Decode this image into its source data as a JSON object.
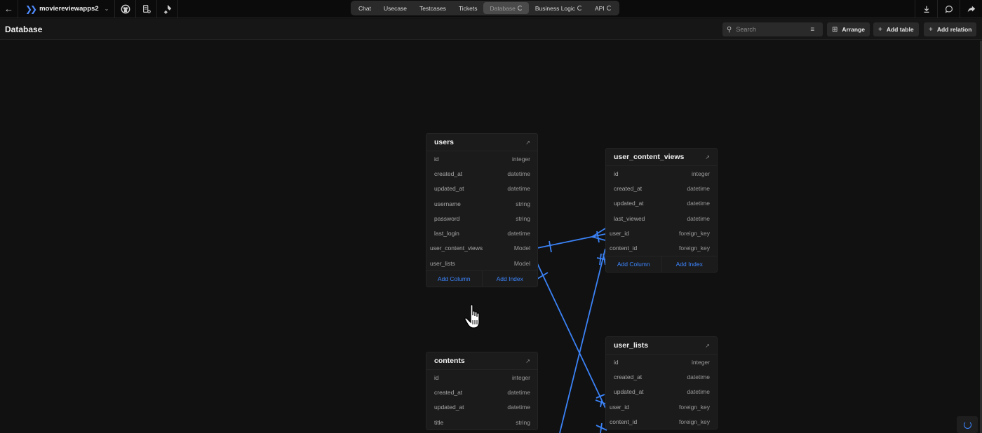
{
  "topbar": {
    "project_name": "moviereviewapps2",
    "tabs": [
      {
        "label": "Chat",
        "active": false,
        "spinner": false
      },
      {
        "label": "Usecase",
        "active": false,
        "spinner": false
      },
      {
        "label": "Testcases",
        "active": false,
        "spinner": false
      },
      {
        "label": "Tickets",
        "active": false,
        "spinner": false
      },
      {
        "label": "Database",
        "active": true,
        "spinner": true
      },
      {
        "label": "Business Logic",
        "active": false,
        "spinner": true
      },
      {
        "label": "API",
        "active": false,
        "spinner": true
      }
    ]
  },
  "header": {
    "title": "Database",
    "search_placeholder": "Search",
    "arrange_label": "Arrange",
    "add_table_label": "Add table",
    "add_relation_label": "Add relation"
  },
  "tables": [
    {
      "name": "users",
      "columns": [
        {
          "name": "id",
          "type": "integer"
        },
        {
          "name": "created_at",
          "type": "datetime"
        },
        {
          "name": "updated_at",
          "type": "datetime"
        },
        {
          "name": "username",
          "type": "string"
        },
        {
          "name": "password",
          "type": "string"
        },
        {
          "name": "last_login",
          "type": "datetime"
        },
        {
          "name": "user_content_views",
          "type": "Model"
        },
        {
          "name": "user_lists",
          "type": "Model"
        }
      ],
      "add_column_label": "Add Column",
      "add_index_label": "Add Index"
    },
    {
      "name": "user_content_views",
      "columns": [
        {
          "name": "id",
          "type": "integer"
        },
        {
          "name": "created_at",
          "type": "datetime"
        },
        {
          "name": "updated_at",
          "type": "datetime"
        },
        {
          "name": "last_viewed",
          "type": "datetime"
        },
        {
          "name": "user_id",
          "type": "foreign_key"
        },
        {
          "name": "content_id",
          "type": "foreign_key"
        }
      ],
      "add_column_label": "Add Column",
      "add_index_label": "Add Index"
    },
    {
      "name": "user_lists",
      "columns": [
        {
          "name": "id",
          "type": "integer"
        },
        {
          "name": "created_at",
          "type": "datetime"
        },
        {
          "name": "updated_at",
          "type": "datetime"
        },
        {
          "name": "user_id",
          "type": "foreign_key"
        },
        {
          "name": "content_id",
          "type": "foreign_key"
        }
      ]
    },
    {
      "name": "contents",
      "columns": [
        {
          "name": "id",
          "type": "integer"
        },
        {
          "name": "created_at",
          "type": "datetime"
        },
        {
          "name": "updated_at",
          "type": "datetime"
        },
        {
          "name": "title",
          "type": "string"
        }
      ]
    }
  ],
  "colors": {
    "accent": "#3d86ff",
    "relation_line": "#3b82f6",
    "canvas": "#111111",
    "table_bg": "#1b1b1b"
  }
}
